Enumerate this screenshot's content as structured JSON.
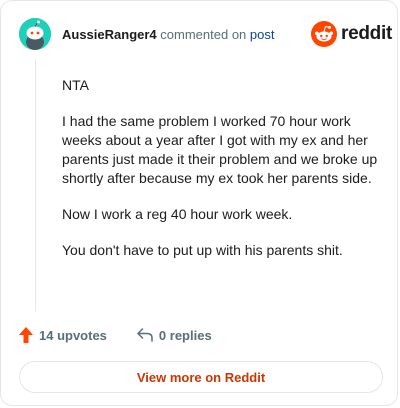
{
  "comment": {
    "username": "AussieRanger4",
    "commented_on": "commented on",
    "post_link": "post",
    "paragraphs": [
      "NTA",
      "I had the same problem I worked 70 hour work weeks about a year after I got with my ex and her parents just made it their problem and we broke up shortly after because my ex took her parents side.",
      "Now I work a reg 40 hour work week.",
      "You don't have to put up with his parents shit."
    ]
  },
  "brand": {
    "name": "reddit",
    "icon": "reddit-logo-icon",
    "color": "#ff4500"
  },
  "actions": {
    "upvotes_label": "14 upvotes",
    "replies_label": "0 replies",
    "upvote_icon": "upvote-arrow-icon",
    "reply_icon": "reply-arrow-icon"
  },
  "view_more_label": "View more on Reddit",
  "colors": {
    "accent": "#ff4500",
    "link": "#0a449b",
    "view_more": "#cc3700",
    "avatar": "#1fd0b8"
  }
}
